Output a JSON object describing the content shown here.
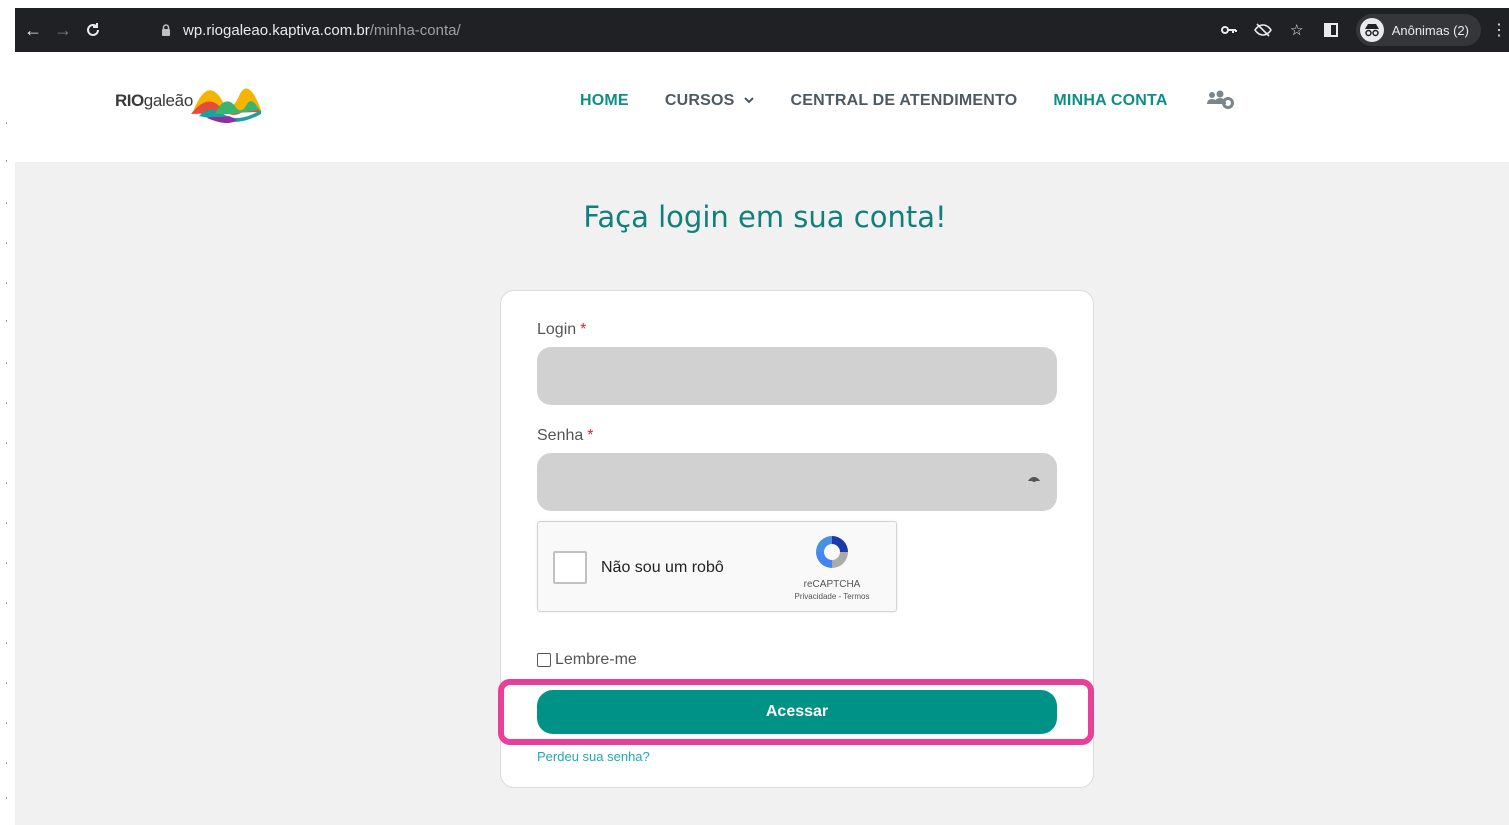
{
  "browser": {
    "url_host": "wp.riogaleao.kaptiva.com.br",
    "url_path": "/minha-conta/",
    "profile_label": "Anônimas (2)"
  },
  "header": {
    "logo_bold": "RIO",
    "logo_light": "galeão",
    "nav": [
      {
        "label": "HOME",
        "active": true
      },
      {
        "label": "CURSOS",
        "has_dropdown": true
      },
      {
        "label": "CENTRAL DE ATENDIMENTO"
      },
      {
        "label": "MINHA CONTA",
        "active": true
      }
    ]
  },
  "login": {
    "title": "Faça login em sua conta!",
    "login_label": "Login",
    "password_label": "Senha",
    "required_mark": "*",
    "login_value": "",
    "password_value": ""
  },
  "recaptcha": {
    "label": "Não sou um robô",
    "brand": "reCAPTCHA",
    "links": "Privacidade - Termos"
  },
  "remember_label": "Lembre-me",
  "submit_label": "Acessar",
  "forgot_label": "Perdeu sua senha?",
  "colors": {
    "accent": "#009187",
    "highlight": "#e8409a",
    "title": "#11807a"
  }
}
